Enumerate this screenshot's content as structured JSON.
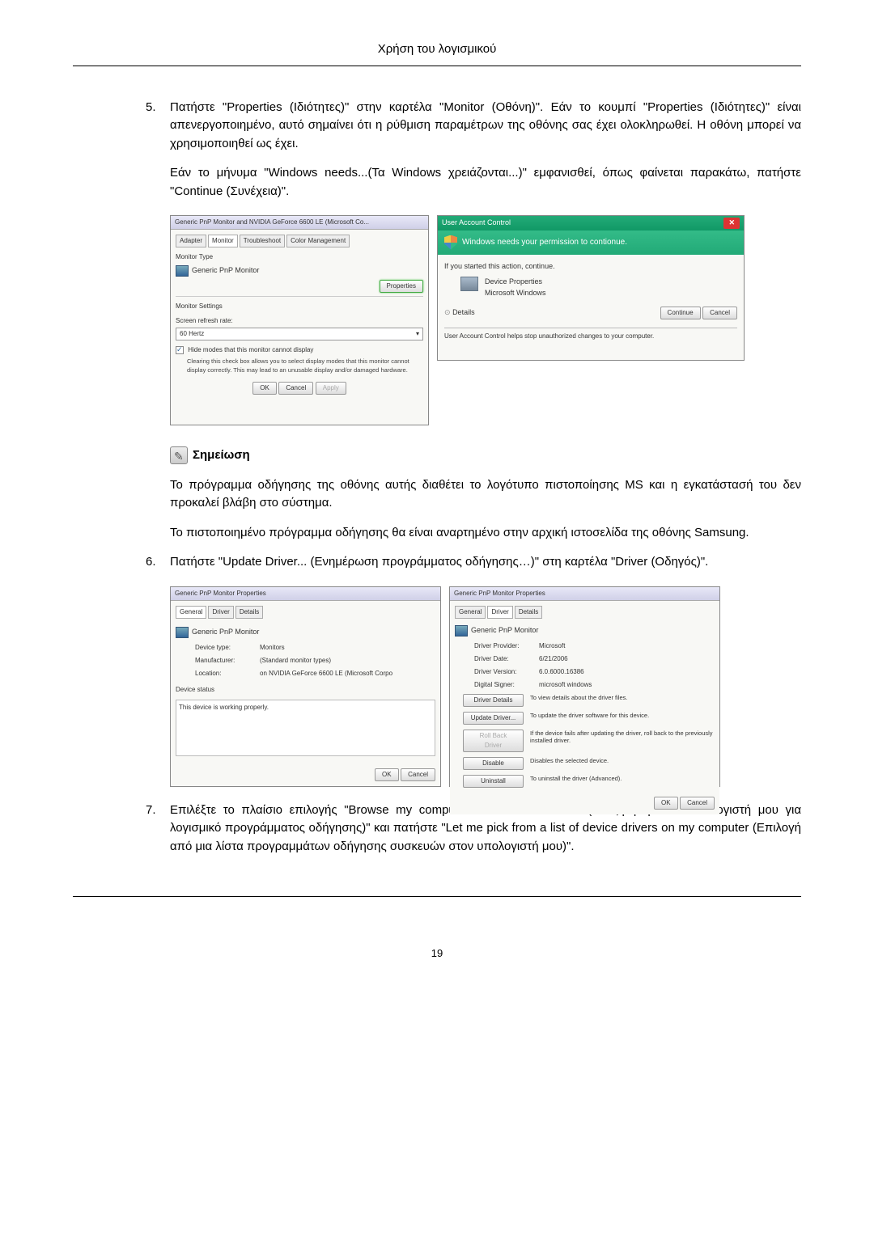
{
  "header": "Χρήση του λογισμικού",
  "items": {
    "5": {
      "num": "5.",
      "text": "Πατήστε \"Properties (Ιδιότητες)\" στην καρτέλα \"Monitor (Οθόνη)\". Εάν το κουμπί \"Properties (Ιδιότητες)\" είναι απενεργοποιημένο, αυτό σημαίνει ότι η ρύθμιση παραμέτρων της οθόνης σας έχει ολοκληρωθεί. Η οθόνη μπορεί να χρησιμοποιηθεί ως έχει.",
      "para2": "Εάν το μήνυμα \"Windows needs...(Τα Windows χρειάζονται...)\" εμφανισθεί, όπως φαίνεται παρακάτω, πατήστε \"Continue (Συνέχεια)\"."
    },
    "6": {
      "num": "6.",
      "text": "Πατήστε \"Update Driver... (Ενημέρωση προγράμματος οδήγησης…)\" στη καρτέλα \"Driver (Οδηγός)\"."
    },
    "7": {
      "num": "7.",
      "text": "Επιλέξτε το πλαίσιο επιλογής \"Browse my computer for driver software (Αναζήτηση στον υπολογιστή μου για λογισμικό προγράμματος οδήγησης)\" και πατήστε \"Let me pick from a list of device drivers on my computer (Επιλογή από μια λίστα προγραμμάτων οδήγησης συσκευών στον υπολογιστή μου)\"."
    }
  },
  "note": {
    "title": "Σημείωση",
    "p1": "Το πρόγραμμα οδήγησης της οθόνης αυτής διαθέτει το λογότυπο πιστοποίησης MS και η εγκατάστασή του δεν προκαλεί βλάβη στο σύστημα.",
    "p2": "Το πιστοποιημένο πρόγραμμα οδήγησης θα είναι αναρτημένο στην αρχική ιστοσελίδα της οθόνης Samsung."
  },
  "shot1": {
    "title": "Generic PnP Monitor and NVIDIA GeForce 6600 LE (Microsoft Co...",
    "tabs": {
      "adapter": "Adapter",
      "monitor": "Monitor",
      "troubleshoot": "Troubleshoot",
      "color": "Color Management"
    },
    "monitorType": "Monitor Type",
    "monitorName": "Generic PnP Monitor",
    "propertiesBtn": "Properties",
    "monitorSettings": "Monitor Settings",
    "refreshLabel": "Screen refresh rate:",
    "refreshValue": "60 Hertz",
    "hideModes": "Hide modes that this monitor cannot display",
    "hideModesDesc": "Clearing this check box allows you to select display modes that this monitor cannot display correctly. This may lead to an unusable display and/or damaged hardware.",
    "ok": "OK",
    "cancel": "Cancel",
    "apply": "Apply"
  },
  "shot2": {
    "titlebar": "User Account Control",
    "banner": "Windows needs your permission to contionue.",
    "ifStarted": "If you started this action, continue.",
    "devProps": "Device Properties",
    "msWindows": "Microsoft Windows",
    "details": "Details",
    "continue": "Continue",
    "cancel": "Cancel",
    "footer": "User Account Control helps stop unauthorized changes to your computer."
  },
  "shot3": {
    "title": "Generic PnP Monitor Properties",
    "tabs": {
      "general": "General",
      "driver": "Driver",
      "details": "Details"
    },
    "monitorName": "Generic PnP Monitor",
    "deviceType": "Device type:",
    "deviceTypeV": "Monitors",
    "manufacturer": "Manufacturer:",
    "manufacturerV": "(Standard monitor types)",
    "location": "Location:",
    "locationV": "on NVIDIA GeForce 6600 LE (Microsoft Corpo",
    "deviceStatus": "Device status",
    "statusText": "This device is working properly.",
    "ok": "OK",
    "cancel": "Cancel"
  },
  "shot4": {
    "title": "Generic PnP Monitor Properties",
    "tabs": {
      "general": "General",
      "driver": "Driver",
      "details": "Details"
    },
    "monitorName": "Generic PnP Monitor",
    "provider": "Driver Provider:",
    "providerV": "Microsoft",
    "date": "Driver Date:",
    "dateV": "6/21/2006",
    "version": "Driver Version:",
    "versionV": "6.0.6000.16386",
    "signer": "Digital Signer:",
    "signerV": "microsoft windows",
    "btnDetails": "Driver Details",
    "descDetails": "To view details about the driver files.",
    "btnUpdate": "Update Driver...",
    "descUpdate": "To update the driver software for this device.",
    "btnRollback": "Roll Back Driver",
    "descRollback": "If the device fails after updating the driver, roll back to the previously installed driver.",
    "btnDisable": "Disable",
    "descDisable": "Disables the selected device.",
    "btnUninstall": "Uninstall",
    "descUninstall": "To uninstall the driver (Advanced).",
    "ok": "OK",
    "cancel": "Cancel"
  },
  "pageNumber": "19"
}
